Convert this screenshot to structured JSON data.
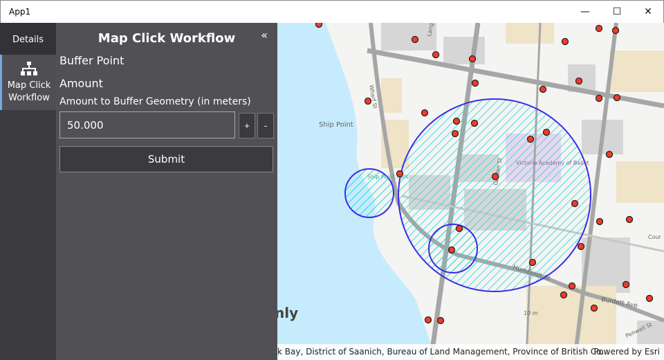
{
  "window": {
    "title": "App1",
    "minimize": "—",
    "maximize": "☐",
    "close": "✕"
  },
  "nav": {
    "items": [
      {
        "label": "Details"
      },
      {
        "label": "Map Click Workflow",
        "icon": "hierarchy-icon"
      }
    ]
  },
  "panel": {
    "title": "Map Click Workflow",
    "collapse_glyph": "«",
    "section": "Buffer Point",
    "amount_heading": "Amount",
    "amount_label": "Amount to Buffer Geometry (in meters)",
    "amount_value": "50.000",
    "increment": "+",
    "decrement": "-",
    "submit": "Submit"
  },
  "map": {
    "labels": {
      "ship_point": "Ship Point",
      "park": "Ship Point Park",
      "ballet": "Victoria Academy of Ballet",
      "humboldt": "Humboldt St",
      "burdett": "Burdett Ave",
      "penwell": "Penwell St",
      "gordon": "Gordon St",
      "langley": "Langley",
      "wharf": "Wharf St",
      "courtney": "Cour",
      "elev": "10 m",
      "partial": "nly"
    },
    "colors": {
      "water": "#c6ebfc",
      "land": "#f4f4f2",
      "building": "#d6d6d6",
      "tan": "#efe3c8",
      "road": "#a6a6a6",
      "buffer_stroke": "#3b2ce6",
      "hatch": "#27d9e0",
      "point": "#f23b28"
    },
    "attribution": "k Bay, District of Saanich, Bureau of Land Management, Province of British Co...",
    "powered_by": "Powered by Esri"
  }
}
